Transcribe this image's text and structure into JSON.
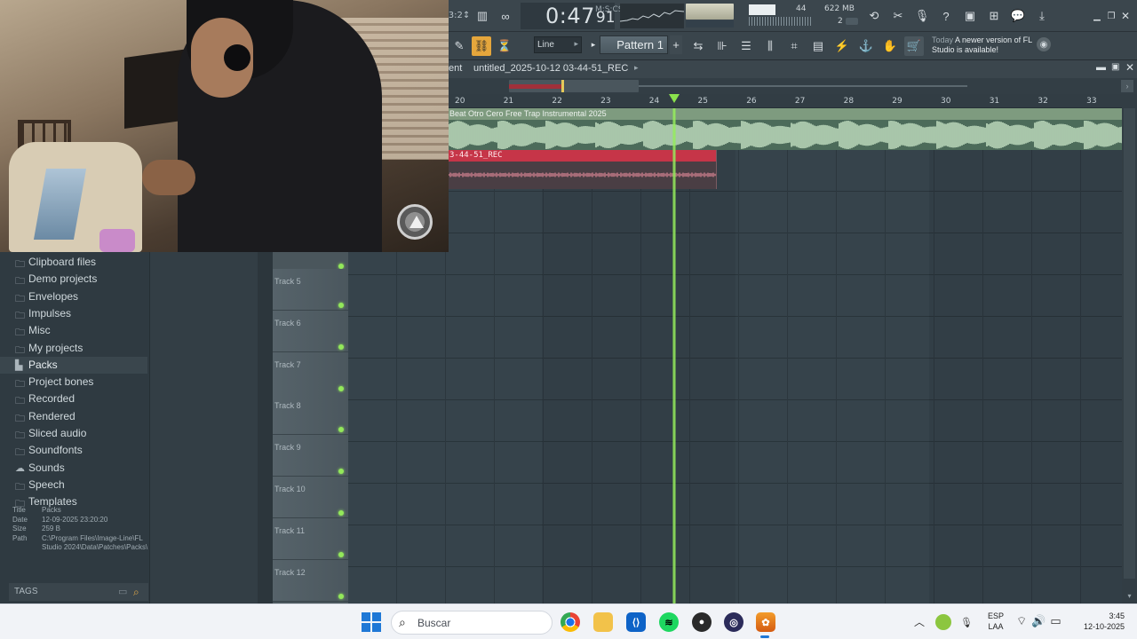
{
  "toolbar": {
    "tempo": "3:2↕",
    "time_main": "0:47",
    "time_sub": "91",
    "time_unit": "M:S:CS",
    "cpu": "44",
    "memory": "622 MB",
    "polyphony": "2",
    "snap": "Line",
    "pattern": "Pattern 1",
    "pattern_add": "+",
    "news_today": "Today",
    "news_text": "A newer version of FL Studio is available!"
  },
  "playlist": {
    "title_prefix": "ent",
    "project": "untitled_2025-10-12 03-44-51_REC",
    "bars": [
      "20",
      "21",
      "22",
      "23",
      "24",
      "25",
      "26",
      "27",
      "28",
      "29",
      "30",
      "31",
      "32",
      "33"
    ],
    "clip1_name": "Beat Otro Cero  Free Trap Instrumental 2025",
    "clip2_name": "3-44-51_REC",
    "tracks": [
      "Track 5",
      "Track 6",
      "Track 7",
      "Track 8",
      "Track 9",
      "Track 10",
      "Track 11",
      "Track 12"
    ],
    "playhead_bar": 24.5
  },
  "browser": {
    "items": [
      {
        "label": "Clipboard files",
        "icon": "folder-icon"
      },
      {
        "label": "Demo projects",
        "icon": "folder-icon"
      },
      {
        "label": "Envelopes",
        "icon": "folder-icon"
      },
      {
        "label": "Impulses",
        "icon": "folder-icon"
      },
      {
        "label": "Misc",
        "icon": "folder-icon"
      },
      {
        "label": "My projects",
        "icon": "folder-icon"
      },
      {
        "label": "Packs",
        "icon": "packs-icon"
      },
      {
        "label": "Project bones",
        "icon": "folder-icon"
      },
      {
        "label": "Recorded",
        "icon": "folder-icon"
      },
      {
        "label": "Rendered",
        "icon": "folder-icon"
      },
      {
        "label": "Sliced audio",
        "icon": "folder-icon"
      },
      {
        "label": "Soundfonts",
        "icon": "folder-icon"
      },
      {
        "label": "Sounds",
        "icon": "cloud-icon"
      },
      {
        "label": "Speech",
        "icon": "folder-icon"
      },
      {
        "label": "Templates",
        "icon": "folder-icon"
      }
    ],
    "info": {
      "title_k": "Title",
      "title_v": "Packs",
      "date_k": "Date",
      "date_v": "12-09-2025 23:20:20",
      "size_k": "Size",
      "size_v": "259 B",
      "path_k": "Path",
      "path_v": "C:\\Program Files\\Image-Line\\FL Studio 2024\\Data\\Patches\\Packs\\"
    },
    "tags_label": "TAGS"
  },
  "taskbar": {
    "search_placeholder": "Buscar",
    "lang_1": "ESP",
    "lang_2": "LAA",
    "time": "3:45",
    "date": "12-10-2025"
  }
}
